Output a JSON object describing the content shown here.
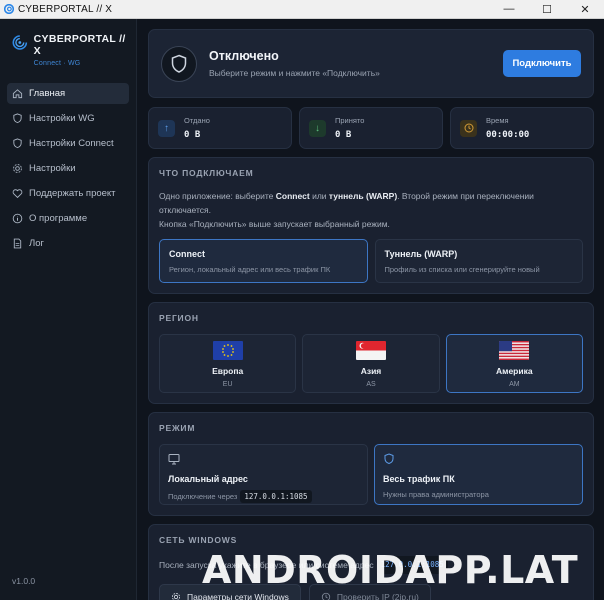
{
  "titlebar": {
    "title": "CYBERPORTAL // X",
    "minimize": "—",
    "maximize": "☐",
    "close": "✕"
  },
  "brand": {
    "name": "CYBERPORTAL // X",
    "sub": "Connect · WG"
  },
  "sidebar": {
    "items": [
      {
        "label": "Главная",
        "icon": "home-icon",
        "active": true
      },
      {
        "label": "Настройки WG",
        "icon": "shield-icon"
      },
      {
        "label": "Настройки Connect",
        "icon": "shield-icon"
      },
      {
        "label": "Настройки",
        "icon": "gear-icon"
      },
      {
        "label": "Поддержать проект",
        "icon": "heart-icon"
      },
      {
        "label": "О программе",
        "icon": "info-icon"
      },
      {
        "label": "Лог",
        "icon": "document-icon"
      }
    ],
    "version": "v1.0.0"
  },
  "status": {
    "title": "Отключено",
    "subtitle": "Выберите режим и нажмите «Подключить»",
    "button": "Подключить"
  },
  "stats": [
    {
      "label": "Отдано",
      "value": "0 B",
      "icon": "arrow-up-icon",
      "color": "#2f6fc4"
    },
    {
      "label": "Принято",
      "value": "0 B",
      "icon": "arrow-down-icon",
      "color": "#3a9a5a"
    },
    {
      "label": "Время",
      "value": "00:00:00",
      "icon": "clock-icon",
      "color": "#c08a2a"
    }
  ],
  "what": {
    "title": "ЧТО ПОДКЛЮЧАЕМ",
    "desc_pre": "Одно приложение: выберите ",
    "desc_b1": "Connect",
    "desc_mid": " или ",
    "desc_b2": "туннель (WARP)",
    "desc_post": ". Второй режим при переключении отключается.",
    "desc_line2": "Кнопка «Подключить» выше запускает выбранный режим.",
    "options": [
      {
        "title": "Connect",
        "sub": "Регион, локальный адрес или весь трафик ПК"
      },
      {
        "title": "Туннель (WARP)",
        "sub": "Профиль из списка или сгенерируйте новый"
      }
    ]
  },
  "region": {
    "title": "РЕГИОН",
    "items": [
      {
        "name": "Европа",
        "code": "EU",
        "flag": "eu-flag-icon"
      },
      {
        "name": "Азия",
        "code": "AS",
        "flag": "singapore-flag-icon"
      },
      {
        "name": "Америка",
        "code": "AM",
        "flag": "us-flag-icon"
      }
    ]
  },
  "mode": {
    "title": "РЕЖИМ",
    "local": {
      "title": "Локальный адрес",
      "sub": "Подключение через",
      "addr": "127.0.0.1:1085"
    },
    "all": {
      "title": "Весь трафик ПК",
      "sub": "Нужны права администратора"
    }
  },
  "windows": {
    "title": "СЕТЬ WINDOWS",
    "desc": "После запуска укажите в браузере или системе адрес",
    "addr": "127.0.0.1:1085",
    "btn_net": "Параметры сети Windows",
    "btn_ip": "Проверить IP (2ip.ru)"
  },
  "watermark": "ANDROIDAPP.LAT"
}
